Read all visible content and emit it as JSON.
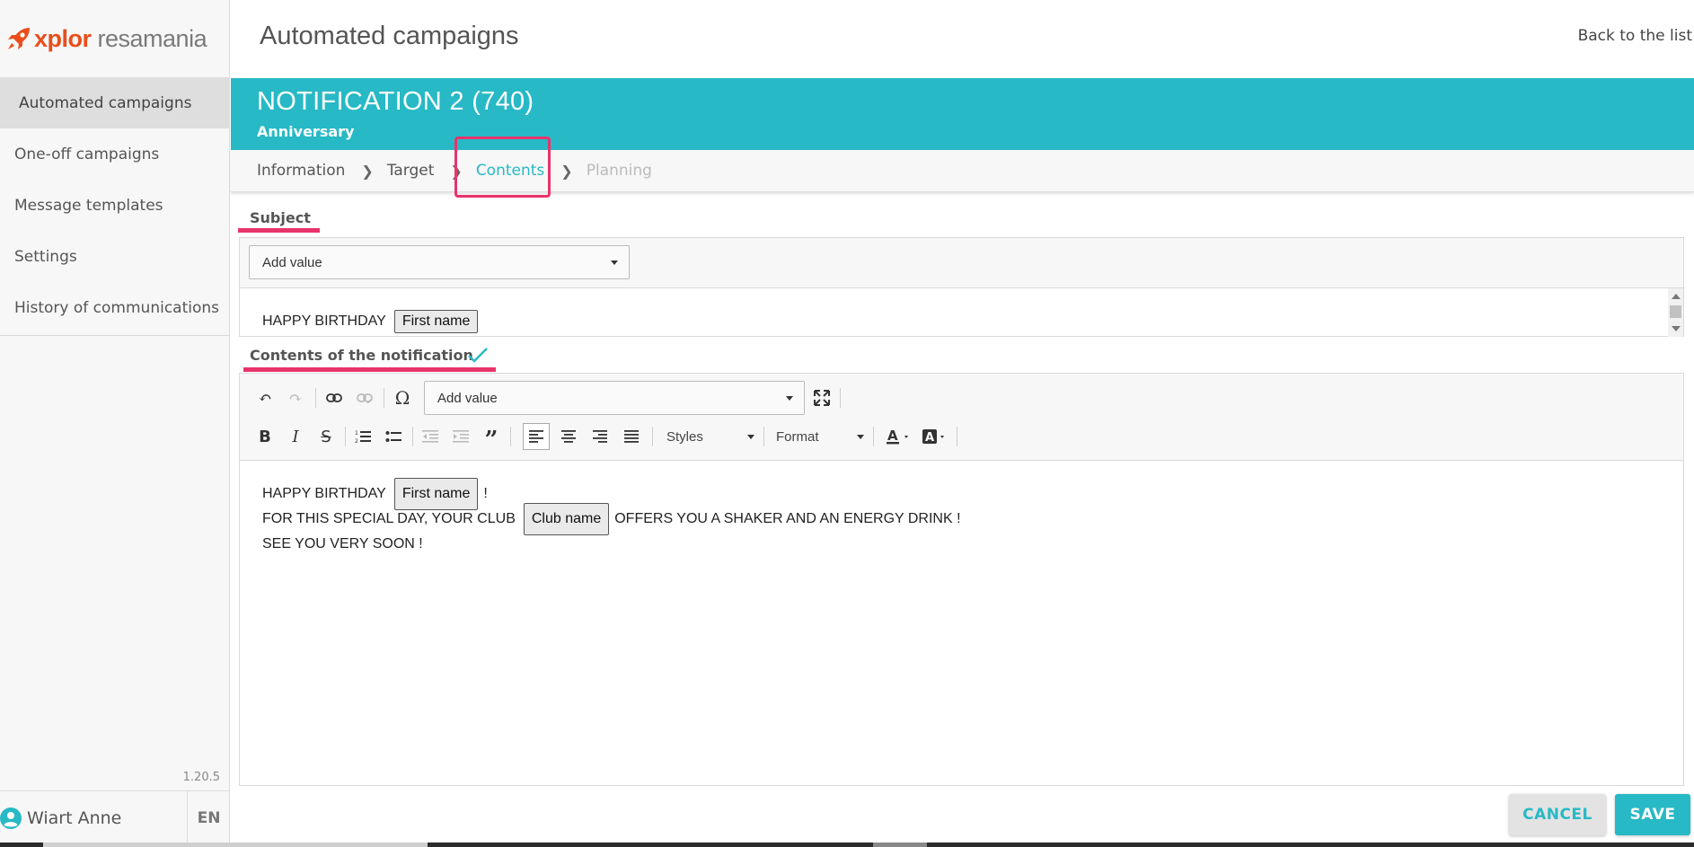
{
  "app": {
    "logo_brand": "xplor",
    "logo_product": "resamania",
    "version": "1.20.5"
  },
  "sidebar": {
    "items": [
      {
        "label": "Automated campaigns",
        "active": true
      },
      {
        "label": "One-off campaigns",
        "active": false
      },
      {
        "label": "Message templates",
        "active": false
      },
      {
        "label": "Settings",
        "active": false
      },
      {
        "label": "History of communications",
        "active": false
      }
    ],
    "user_name": "Wiart Anne",
    "language": "EN"
  },
  "header": {
    "title": "Automated campaigns",
    "back_link": "Back to the list"
  },
  "campaign": {
    "title": "NOTIFICATION 2 (740)",
    "subtitle": "Anniversary"
  },
  "steps": [
    {
      "label": "Information",
      "state": "done"
    },
    {
      "label": "Target",
      "state": "done"
    },
    {
      "label": "Contents",
      "state": "current"
    },
    {
      "label": "Planning",
      "state": "disabled"
    }
  ],
  "subject": {
    "label": "Subject",
    "add_value_select": "Add value",
    "text": "HAPPY BIRTHDAY",
    "tag": "First name"
  },
  "contents": {
    "label": "Contents of the notification",
    "add_value_select": "Add value",
    "styles_combo": "Styles",
    "format_combo": "Format",
    "lines": [
      {
        "before": "HAPPY BIRTHDAY",
        "tag": "First name",
        "after": "!"
      },
      {
        "before": "FOR THIS SPECIAL DAY, YOUR CLUB",
        "tag": "Club name",
        "after": "OFFERS YOU A SHAKER AND AN ENERGY DRINK !"
      },
      {
        "before": "SEE YOU VERY SOON !",
        "tag": "",
        "after": ""
      }
    ]
  },
  "actions": {
    "cancel": "CANCEL",
    "save": "SAVE"
  },
  "colors": {
    "accent": "#27b9c5",
    "highlight": "#e8336b",
    "brand": "#e94e1b"
  }
}
